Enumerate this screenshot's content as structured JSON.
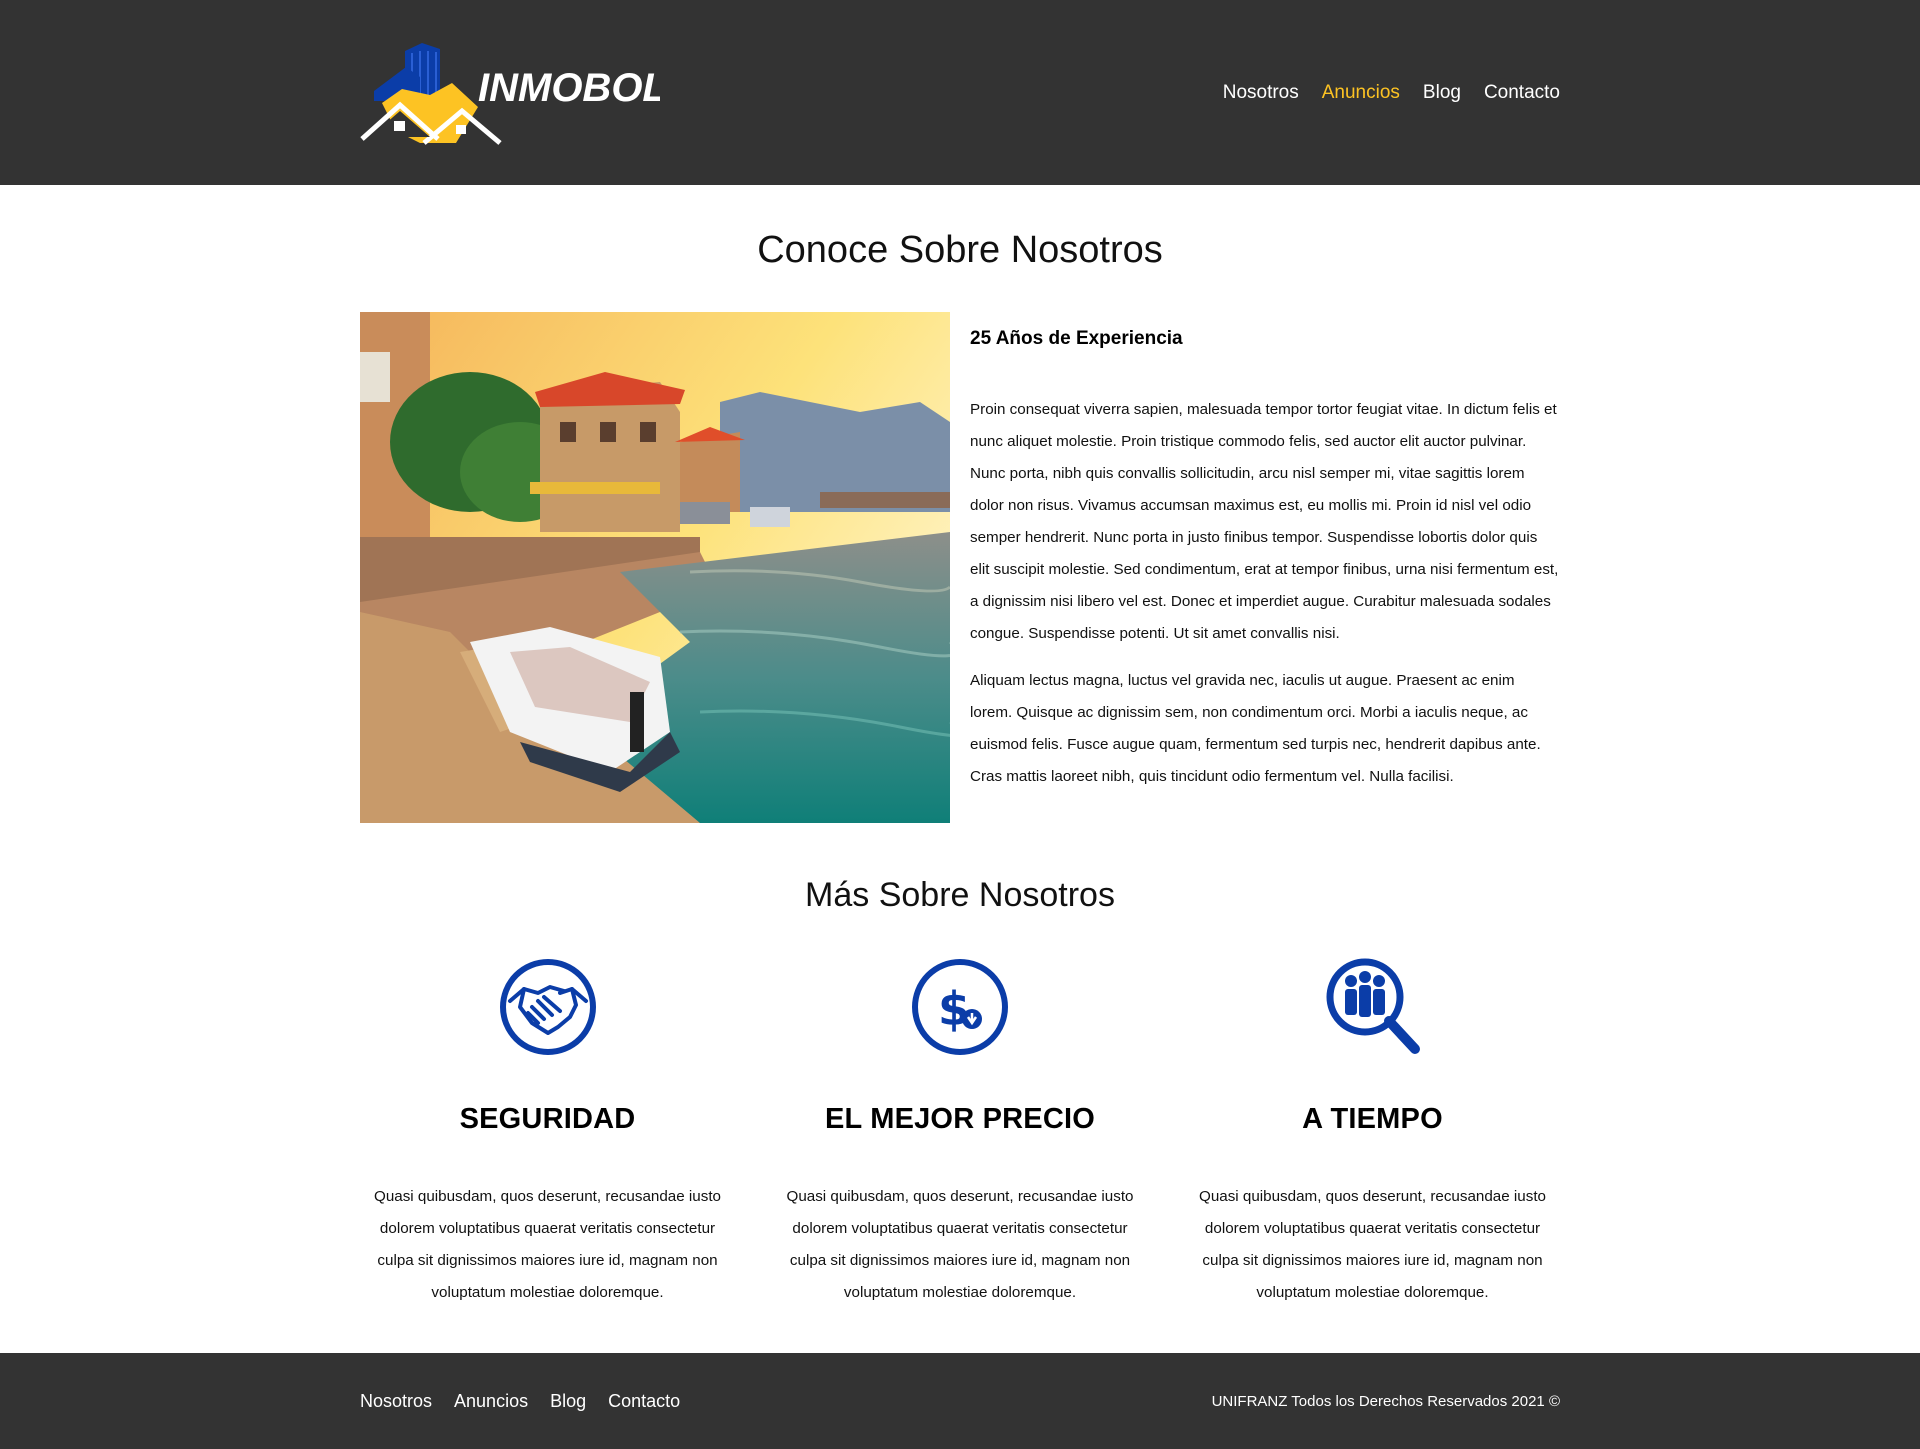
{
  "header": {
    "logo_text": "INMOBOL",
    "nav": [
      {
        "label": "Nosotros",
        "active": false
      },
      {
        "label": "Anuncios",
        "active": true
      },
      {
        "label": "Blog",
        "active": false
      },
      {
        "label": "Contacto",
        "active": false
      }
    ]
  },
  "about": {
    "title": "Conoce Sobre Nosotros",
    "subtitle": "25 Años de Experiencia",
    "paragraphs": [
      "Proin consequat viverra sapien, malesuada tempor tortor feugiat vitae. In dictum felis et nunc aliquet molestie. Proin tristique commodo felis, sed auctor elit auctor pulvinar. Nunc porta, nibh quis convallis sollicitudin, arcu nisl semper mi, vitae sagittis lorem dolor non risus. Vivamus accumsan maximus est, eu mollis mi. Proin id nisl vel odio semper hendrerit. Nunc porta in justo finibus tempor. Suspendisse lobortis dolor quis elit suscipit molestie. Sed condimentum, erat at tempor finibus, urna nisi fermentum est, a dignissim nisi libero vel est. Donec et imperdiet augue. Curabitur malesuada sodales congue. Suspendisse potenti. Ut sit amet convallis nisi.",
      "Aliquam lectus magna, luctus vel gravida nec, iaculis ut augue. Praesent ac enim lorem. Quisque ac dignissim sem, non condimentum orci. Morbi a iaculis neque, ac euismod felis. Fusce augue quam, fermentum sed turpis nec, hendrerit dapibus ante. Cras mattis laoreet nibh, quis tincidunt odio fermentum vel. Nulla facilisi."
    ]
  },
  "more": {
    "title": "Más Sobre Nosotros",
    "features": [
      {
        "icon": "handshake-icon",
        "heading": "SEGURIDAD",
        "text": "Quasi quibusdam, quos deserunt, recusandae iusto dolorem voluptatibus quaerat veritatis consectetur culpa sit dignissimos maiores iure id, magnam non voluptatum molestiae doloremque."
      },
      {
        "icon": "dollar-icon",
        "heading": "EL MEJOR PRECIO",
        "text": "Quasi quibusdam, quos deserunt, recusandae iusto dolorem voluptatibus quaerat veritatis consectetur culpa sit dignissimos maiores iure id, magnam non voluptatum molestiae doloremque."
      },
      {
        "icon": "people-search-icon",
        "heading": "A TIEMPO",
        "text": "Quasi quibusdam, quos deserunt, recusandae iusto dolorem voluptatibus quaerat veritatis consectetur culpa sit dignissimos maiores iure id, magnam non voluptatum molestiae doloremque."
      }
    ]
  },
  "footer": {
    "nav": [
      "Nosotros",
      "Anuncios",
      "Blog",
      "Contacto"
    ],
    "copyright": "UNIFRANZ Todos los Derechos Reservados 2021 ©"
  },
  "colors": {
    "header_bg": "#333333",
    "accent": "#FDC323",
    "icon_blue": "#0B3DA8"
  }
}
